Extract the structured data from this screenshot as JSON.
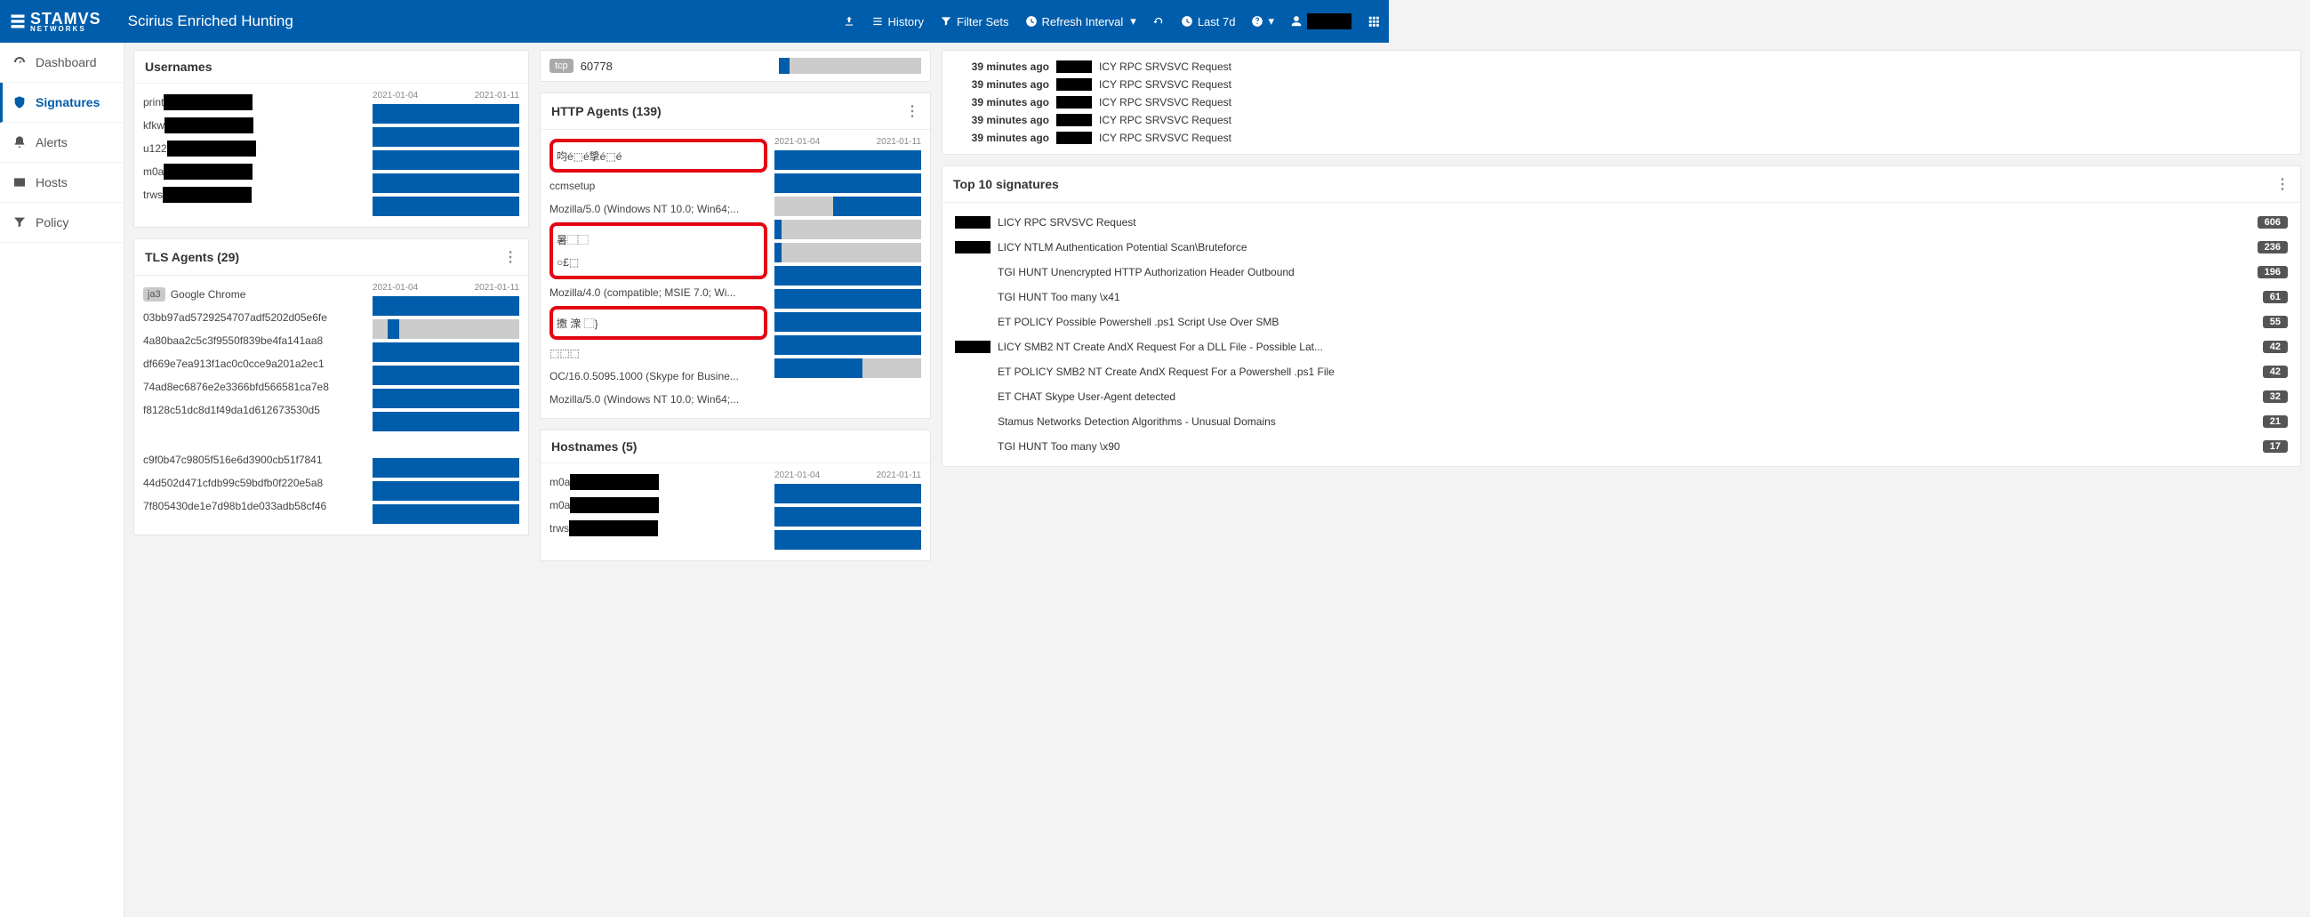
{
  "header": {
    "brand_big": "STAMVS",
    "brand_sub": "NETWORKS",
    "app_title": "Scirius Enriched Hunting",
    "links": {
      "history": "History",
      "filter_sets": "Filter Sets",
      "refresh_interval": "Refresh Interval",
      "time_range": "Last 7d"
    }
  },
  "nav": {
    "dashboard": "Dashboard",
    "signatures": "Signatures",
    "alerts": "Alerts",
    "hosts": "Hosts",
    "policy": "Policy"
  },
  "tcp_partial": {
    "proto": "tcp",
    "port": "60778"
  },
  "usernames": {
    "title": "Usernames",
    "axis_start": "2021-01-04",
    "axis_end": "2021-01-11",
    "items": [
      {
        "prefix": "print"
      },
      {
        "prefix": "kfkw"
      },
      {
        "prefix": "u122"
      },
      {
        "prefix": "m0a"
      },
      {
        "prefix": "trws"
      }
    ]
  },
  "tls_agents": {
    "title": "TLS Agents (29)",
    "axis_start": "2021-01-04",
    "axis_end": "2021-01-11",
    "ja3_label": "ja3",
    "chrome_label": "Google Chrome",
    "hashes_a": [
      "03bb97ad5729254707adf5202d05e6fe",
      "4a80baa2c5c3f9550f839be4fa141aa8",
      "df669e7ea913f1ac0c0cce9a201a2ec1",
      "74ad8ec6876e2e3366bfd566581ca7e8",
      "f8128c51dc8d1f49da1d612673530d5"
    ],
    "hashes_b": [
      "c9f0b47c9805f516e6d3900cb51f7841",
      "44d502d471cfdb99c59bdfb0f220e5a8",
      "7f805430de1e7d98b1de033adb58cf46"
    ]
  },
  "http_agents": {
    "title": "HTTP Agents (139)",
    "axis_start": "2021-01-04",
    "axis_end": "2021-01-11",
    "items": [
      {
        "label": "呁é⬚é㨼é⬚é",
        "red": true,
        "fill_left": 0,
        "fill_w": 100
      },
      {
        "label": "ccmsetup",
        "red": false,
        "fill_left": 0,
        "fill_w": 100
      },
      {
        "label": "Mozilla/5.0 (Windows NT 10.0; Win64;...",
        "red": false,
        "fill_left": 40,
        "fill_w": 60
      },
      {
        "label": "暑⬚⬚",
        "red": true,
        "fill_left": 0,
        "fill_w": 5,
        "bg": true
      },
      {
        "label": "○£⬚",
        "red": false,
        "fill_left": 0,
        "fill_w": 5,
        "bg": true
      },
      {
        "label": "Mozilla/4.0 (compatible; MSIE 7.0; Wi...",
        "red": false,
        "fill_left": 0,
        "fill_w": 100
      },
      {
        "label": "㩤 潨 ⬚}",
        "red": true,
        "fill_left": 0,
        "fill_w": 100
      },
      {
        "label": "⬚⬚⬚",
        "red": false,
        "fill_left": 0,
        "fill_w": 100
      },
      {
        "label": "OC/16.0.5095.1000 (Skype for Busine...",
        "red": false,
        "fill_left": 0,
        "fill_w": 100
      },
      {
        "label": "Mozilla/5.0 (Windows NT 10.0; Win64;...",
        "red": false,
        "fill_left": 0,
        "fill_w": 60
      }
    ]
  },
  "hostnames": {
    "title": "Hostnames (5)",
    "axis_start": "2021-01-04",
    "axis_end": "2021-01-11",
    "items": [
      {
        "prefix": "m0a"
      },
      {
        "prefix": "m0a"
      },
      {
        "prefix": "trws"
      }
    ]
  },
  "recent_events": [
    {
      "time": "39 minutes ago",
      "desc": "ICY RPC SRVSVC Request"
    },
    {
      "time": "39 minutes ago",
      "desc": "ICY RPC SRVSVC Request"
    },
    {
      "time": "39 minutes ago",
      "desc": "ICY RPC SRVSVC Request"
    },
    {
      "time": "39 minutes ago",
      "desc": "ICY RPC SRVSVC Request"
    },
    {
      "time": "39 minutes ago",
      "desc": "ICY RPC SRVSVC Request"
    }
  ],
  "top10": {
    "title": "Top 10 signatures",
    "items": [
      {
        "name": "LICY RPC SRVSVC Request",
        "count": "606",
        "redact": true
      },
      {
        "name": "LICY NTLM Authentication Potential Scan\\Bruteforce",
        "count": "236",
        "redact": true
      },
      {
        "name": "TGI HUNT Unencrypted HTTP Authorization Header Outbound",
        "count": "196",
        "redact": false
      },
      {
        "name": "TGI HUNT Too many \\x41",
        "count": "61",
        "redact": false
      },
      {
        "name": "ET POLICY Possible Powershell .ps1 Script Use Over SMB",
        "count": "55",
        "redact": false
      },
      {
        "name": "LICY SMB2 NT Create AndX Request For a DLL File - Possible Lat...",
        "count": "42",
        "redact": true
      },
      {
        "name": "ET POLICY SMB2 NT Create AndX Request For a Powershell .ps1 File",
        "count": "42",
        "redact": false
      },
      {
        "name": "ET CHAT Skype User-Agent detected",
        "count": "32",
        "redact": false
      },
      {
        "name": "Stamus Networks Detection Algorithms - Unusual Domains",
        "count": "21",
        "redact": false
      },
      {
        "name": "TGI HUNT Too many \\x90",
        "count": "17",
        "redact": false
      }
    ]
  },
  "chart_data": [
    {
      "type": "bar",
      "title": "Usernames",
      "orientation": "horizontal",
      "xlim": [
        "2021-01-04",
        "2021-01-11"
      ],
      "categories": [
        "print…",
        "kfkw…",
        "u122…",
        "m0a…",
        "trws…"
      ],
      "values": [
        100,
        100,
        100,
        100,
        100
      ],
      "note": "each bar fully spans the date range"
    },
    {
      "type": "bar",
      "title": "TLS Agents (29)",
      "orientation": "horizontal",
      "xlim": [
        "2021-01-04",
        "2021-01-11"
      ],
      "categories": [
        "Google Chrome",
        "03bb97ad…",
        "4a80baa2…",
        "df669e7e…",
        "74ad8ec6…",
        "f8128c51…",
        "c9f0b47c…",
        "44d502d4…",
        "7f805430…"
      ],
      "values": [
        100,
        8,
        100,
        100,
        100,
        100,
        100,
        100,
        100
      ],
      "note": "second hash shows small segment near start of range"
    },
    {
      "type": "bar",
      "title": "HTTP Agents (139)",
      "orientation": "horizontal",
      "xlim": [
        "2021-01-04",
        "2021-01-11"
      ],
      "categories": [
        "garbled-1",
        "ccmsetup",
        "Mozilla/5.0 Win10 x64",
        "garbled-2",
        "garbled-3",
        "Mozilla/4.0 MSIE7",
        "garbled-4",
        "garbled-5",
        "OC/16.0.5095.1000 Skype",
        "Mozilla/5.0 Win10 x64 (2)"
      ],
      "series": [
        {
          "name": "active",
          "values": [
            100,
            100,
            60,
            5,
            5,
            100,
            100,
            100,
            100,
            60
          ]
        }
      ]
    },
    {
      "type": "bar",
      "title": "Hostnames (5)",
      "orientation": "horizontal",
      "xlim": [
        "2021-01-04",
        "2021-01-11"
      ],
      "categories": [
        "m0a…",
        "m0a…",
        "trws…"
      ],
      "values": [
        100,
        100,
        100
      ]
    },
    {
      "type": "table",
      "title": "Top 10 signatures",
      "columns": [
        "signature",
        "count"
      ],
      "rows": [
        [
          "…LICY RPC SRVSVC Request",
          606
        ],
        [
          "…LICY NTLM Authentication Potential Scan\\Bruteforce",
          236
        ],
        [
          "TGI HUNT Unencrypted HTTP Authorization Header Outbound",
          196
        ],
        [
          "TGI HUNT Too many \\x41",
          61
        ],
        [
          "ET POLICY Possible Powershell .ps1 Script Use Over SMB",
          55
        ],
        [
          "…LICY SMB2 NT Create AndX Request For a DLL File - Possible Lat…",
          42
        ],
        [
          "ET POLICY SMB2 NT Create AndX Request For a Powershell .ps1 File",
          42
        ],
        [
          "ET CHAT Skype User-Agent detected",
          32
        ],
        [
          "Stamus Networks Detection Algorithms - Unusual Domains",
          21
        ],
        [
          "TGI HUNT Too many \\x90",
          17
        ]
      ]
    }
  ]
}
